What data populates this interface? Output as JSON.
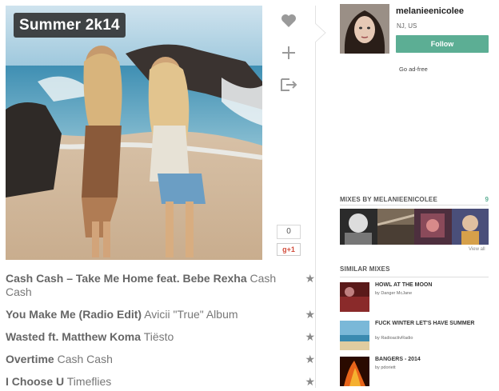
{
  "mix": {
    "title": "Summer 2k14"
  },
  "actions": {
    "like_icon": "heart-icon",
    "add_icon": "plus-icon",
    "share_icon": "share-icon",
    "counter": "0",
    "gplus_label": "g+1"
  },
  "tracks": [
    {
      "title": "Cash Cash – Take Me Home feat. Bebe Rexha",
      "artist": "Cash Cash"
    },
    {
      "title": "You Make Me (Radio Edit)",
      "artist": "Avicii \"True\" Album"
    },
    {
      "title": "Wasted ft. Matthew Koma",
      "artist": "Tiësto"
    },
    {
      "title": "Overtime",
      "artist": "Cash Cash"
    },
    {
      "title": "I Choose U",
      "artist": "Timeflies"
    }
  ],
  "profile": {
    "username": "melanieenicolee",
    "location": "NJ, US",
    "follow_label": "Follow",
    "ad_free_label": "Go ad-free"
  },
  "mixes_by": {
    "heading": "MIXES BY MELANIEENICOLEE",
    "count": "9",
    "view_all": "View all"
  },
  "similar": {
    "heading": "SIMILAR MIXES",
    "items": [
      {
        "title": "HOWL AT THE MOON",
        "by": "by Danger McJane"
      },
      {
        "title": "FUCK WINTER LET'S HAVE SUMMER",
        "by": "by RadioactivRadio"
      },
      {
        "title": "BANGERS - 2014",
        "by": "by pdoriett"
      }
    ]
  },
  "colors": {
    "accent": "#5cae94",
    "star": "#8a8a8a"
  }
}
